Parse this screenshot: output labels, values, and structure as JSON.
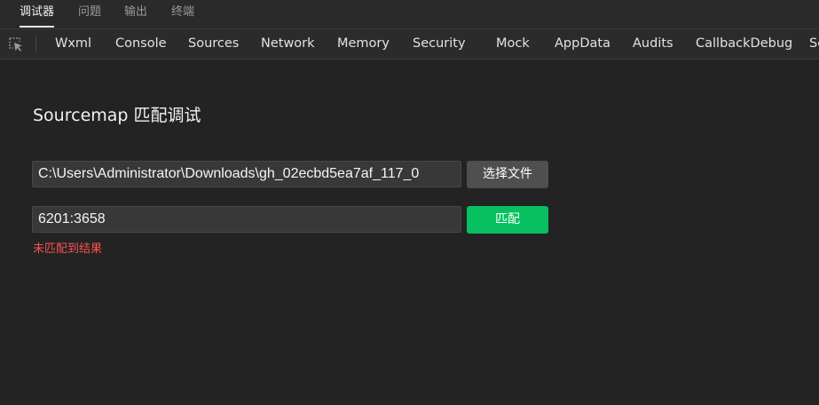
{
  "top_tabs": [
    {
      "label": "调试器",
      "active": true
    },
    {
      "label": "问题",
      "active": false
    },
    {
      "label": "输出",
      "active": false
    },
    {
      "label": "终端",
      "active": false
    }
  ],
  "panel_tabs": [
    "Wxml",
    "Console",
    "Sources",
    "Network",
    "Memory",
    "Security",
    "Mock",
    "AppData",
    "Audits",
    "CallbackDebug",
    "Se"
  ],
  "page": {
    "title": "Sourcemap 匹配调试",
    "file_path_value": "C:\\Users\\Administrator\\Downloads\\gh_02ecbd5ea7af_117_0",
    "choose_file_label": "选择文件",
    "position_value": "6201:3658",
    "match_label": "匹配",
    "result_message": "未匹配到结果"
  },
  "colors": {
    "background": "#232323",
    "accent_green": "#07c160",
    "error_red": "#fa5151"
  },
  "icons": {
    "inspect": "element-picker-icon"
  }
}
